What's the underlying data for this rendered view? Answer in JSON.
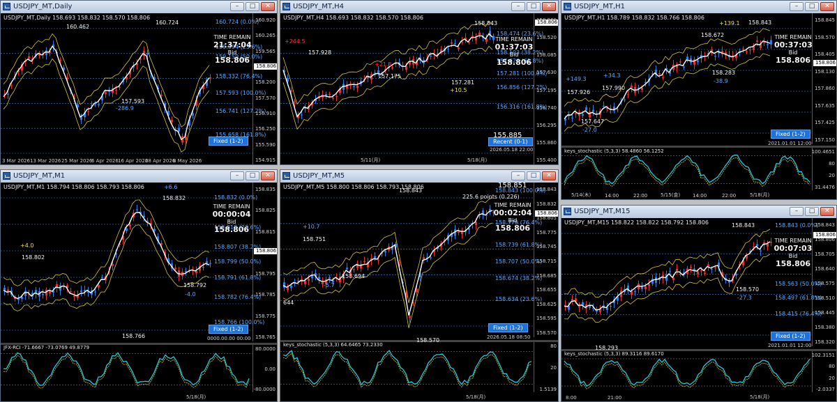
{
  "windows": [
    {
      "id": "w1",
      "title": "USDJPY_MT,Daily",
      "info": "USDJPY_MT,Daily  158.693 158.832 158.570 158.806",
      "axis": [
        "160.920",
        "160.265",
        "159.565",
        "158.806",
        "158.200",
        "157.570",
        "156.910",
        "156.250",
        "155.590",
        "154.915"
      ],
      "xlabels": [
        "3 Mar 2026",
        "13 Mar 2026",
        "25 Mar 2026",
        "6 Apr 2026",
        "16 Apr 2026",
        "28 Apr 2026",
        "8 May 2026"
      ],
      "levels": [
        "160.724 (0.0%)",
        "159.994 (23.6%)",
        "159.159 (50.0%)",
        "158.332 (76.4%)",
        "157.593 (100.0%)",
        "156.741 (127.2%)",
        "155.658 (161.8%)"
      ],
      "labels": {
        "hi": "160.724",
        "hi2": "160.462",
        "lo": "157.593",
        "diff": "-286.9"
      },
      "overlay": {
        "title": "TIME REMAIN",
        "time": "21:37:04",
        "bid": "Bid",
        "price": "158.806"
      },
      "fixed": "Fixed (1-2)"
    },
    {
      "id": "w2",
      "title": "USDJPY_MT,H4",
      "info": "USDJPY_MT,H4  158.693 158.832 158.570 158.806",
      "axis": [
        "158.960",
        "158.520",
        "158.085",
        "157.630",
        "157.195",
        "156.740",
        "156.295",
        "155.860",
        "155.400"
      ],
      "xlabels": [
        "5/11(月)",
        "5/18(月)"
      ],
      "levels": [
        "158.474 (23.6%)",
        "158.103 (38.2%)",
        "157.626 (61.8%)",
        "157.281 (100.0%)",
        "156.856 (127.2%)",
        "156.316 (161.8%)"
      ],
      "labels": {
        "hi": "158.843",
        "l1": "157.928",
        "l2": "+244.5",
        "l3": "157.175",
        "l4": "157.281",
        "l5": "+10.5",
        "l6": "+21.3",
        "big": "155.885"
      },
      "overlay": {
        "title": "TIME REMAIN",
        "time": "01:37:03",
        "bid": "Bid",
        "price": "158.806"
      },
      "fixed": "Recent (0-1)",
      "date": "2026.05.18 22:00"
    },
    {
      "id": "w3",
      "title": "USDJPY_MT,H1",
      "info": "USDJPY_MT,H1  158.789 158.832 158.766 158.806",
      "axis": [
        "158.845",
        "158.570",
        "158.405",
        "158.130",
        "157.860",
        "157.635",
        "157.425",
        "157.150"
      ],
      "xlabels": [
        "5/14(木)",
        "14:00",
        "22:00",
        "5/15(金)",
        "14:00",
        "22:00",
        "5/18(月)"
      ],
      "levels": [
        "158.843",
        "158.672",
        "158.283"
      ],
      "labels": {
        "hi": "158.843",
        "l1": "+139.1",
        "l2": "158.672",
        "l3": "158.283",
        "l4": "-38.9",
        "l5": "+149.3",
        "l6": "+34.3",
        "l7": "157.926",
        "l8": "157.990",
        "l9": "157.647",
        "l10": "-27.0"
      },
      "overlay": {
        "title": "TIME REMAIN",
        "time": "00:37:03",
        "bid": "Bid",
        "price": "158.806"
      },
      "fixed": "Fixed (1-2)",
      "date": "2021.01.01 12:00",
      "sub": {
        "label": "keys_stochastic (5,3,3) 58.4860 56.1252",
        "axis": [
          "100.4651",
          "80",
          "20",
          "31.4476"
        ]
      }
    },
    {
      "id": "w4",
      "title": "USDJPY_MT,M1",
      "info": "USDJPY_MT,M1  158.794 158.806 158.793 158.806",
      "axis": [
        "158.835",
        "158.825",
        "158.815",
        "158.806",
        "158.795",
        "158.785",
        "158.775",
        "158.765"
      ],
      "xlabels": [
        "5/18(月)"
      ],
      "levels": [
        "158.832 (0.0%)",
        "158.818 (23.6%)",
        "158.807 (38.2%)",
        "158.799 (50.0%)",
        "158.791 (61.8%)",
        "158.782 (76.4%)",
        "158.766 (100.0%)"
      ],
      "labels": {
        "hi": "158.832",
        "l1": "+6.6",
        "l2": "+4.0",
        "l3": "158.802",
        "l4": "158.792",
        "l5": "-4.0",
        "l6": "158.766"
      },
      "overlay": {
        "title": "TIME REMAIN",
        "time": "00:00:04",
        "bid": "Bid",
        "price": "158.806"
      },
      "fixed": "Fixed (1-2)",
      "date": "0000.00.00 00:00",
      "sub": {
        "label": "JFX-RCI -71.6667 -73.0769 49.8779",
        "axis": [
          "80.0000",
          "0.00",
          "-80.0000"
        ]
      }
    },
    {
      "id": "w5",
      "title": "USDJPY_MT,M5",
      "info": "USDJPY_MT,M5  158.800 158.806 158.793 158.806",
      "axis": [
        "158.843",
        "158.832",
        "158.805",
        "158.775",
        "158.745",
        "158.715",
        "158.685",
        "158.655",
        "158.625",
        "158.595",
        "158.570"
      ],
      "xlabels": [
        "5/18(月)"
      ],
      "levels": [
        "158.843 (100.0%)",
        "158.779 (76.4%)",
        "158.739 (61.8%)",
        "158.707 (50.0%)",
        "158.674 (38.2%)",
        "158.634 (23.6%)",
        "158.570 (0.0%)"
      ],
      "labels": {
        "hi": "158.843",
        "l1": "158.751",
        "l2": "158.694",
        "l3": "+10.7",
        "l4": "-5.7",
        "l5": "644",
        "l6": "158.570",
        "top": "158.851",
        "pts": "225.6 points (0.226)"
      },
      "overlay": {
        "title": "TIME REMAIN",
        "time": "00:02:04",
        "bid": "Bid",
        "price": "158.806"
      },
      "fixed": "Fixed (1-2)",
      "date": "2026.05.18 08:50",
      "sub": {
        "label": "keys_stochastic (5,3,3) 64.6465 73.2330",
        "axis": [
          "80",
          "20",
          "1.5139"
        ]
      }
    },
    {
      "id": "w6",
      "title": "USDJPY_MT,M15",
      "info": "USDJPY_MT,M15  158.822 158.822 158.792 158.806",
      "axis": [
        "158.843",
        "158.806",
        "158.705",
        "158.640",
        "158.575",
        "158.510",
        "158.445",
        "158.380",
        "158.320"
      ],
      "xlabels": [
        "8:00",
        "21:00",
        "5/18(月)"
      ],
      "levels": [
        "158.843 (0.0%)",
        "158.563 (50.0%)",
        "158.497 (61.8%)",
        "158.415 (76.4%)"
      ],
      "labels": {
        "hi": "158.843",
        "l1": "158.570",
        "l2": "-27.3",
        "l3": "158.293"
      },
      "overlay": {
        "title": "TIME REMAIN",
        "time": "00:07:03",
        "bid": "Bid",
        "price": "158.806"
      },
      "fixed": "Fixed (1-2)",
      "date": "2021.01.01 12:00",
      "sub": {
        "label": "keys_stochastic (5,3,3) 89.3116 89.6170",
        "axis": [
          "102.3151",
          "80",
          "20",
          "-2.0337"
        ]
      }
    }
  ],
  "buttons": {
    "min": "–",
    "max": "□",
    "close": "✕"
  },
  "colors": {
    "blue_level": "#3a8ee6",
    "up": "#2f7be8",
    "down": "#e83030",
    "ma_white": "#ffffff",
    "band_yellow": "#d8c43a",
    "stoch": "#25c8d8"
  }
}
